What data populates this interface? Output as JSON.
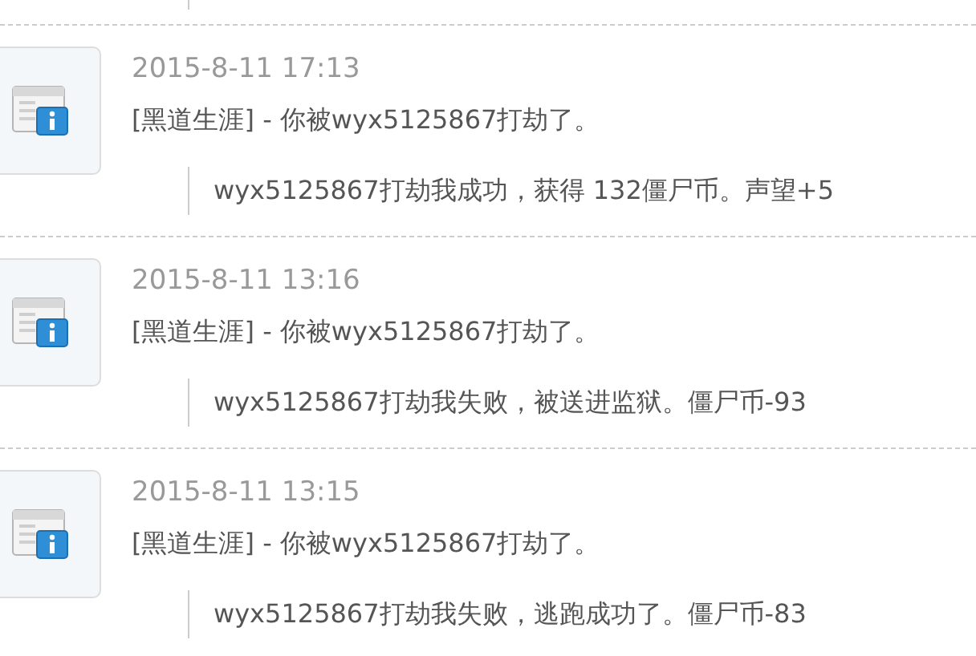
{
  "entries": [
    {
      "time": "2015-8-11 17:13",
      "message": "[黑道生涯] - 你被wyx5125867打劫了。",
      "detail": "wyx5125867打劫我成功，获得 132僵尸币。声望+5"
    },
    {
      "time": "2015-8-11 13:16",
      "message": "[黑道生涯] - 你被wyx5125867打劫了。",
      "detail": "wyx5125867打劫我失败，被送进监狱。僵尸币-93"
    },
    {
      "time": "2015-8-11 13:15",
      "message": "[黑道生涯] - 你被wyx5125867打劫了。",
      "detail": "wyx5125867打劫我失败，逃跑成功了。僵尸币-83"
    }
  ]
}
